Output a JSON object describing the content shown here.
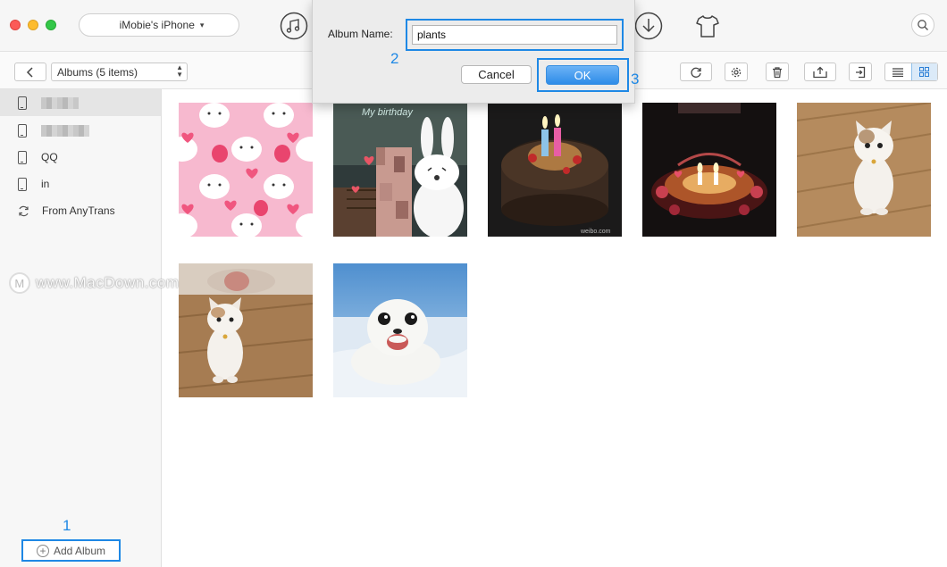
{
  "window": {
    "device_name": "iMobie's iPhone"
  },
  "header_icons": [
    "music-icon",
    "download-icon",
    "tshirt-icon",
    "search-icon"
  ],
  "toolbar": {
    "album_filter": "Albums (5 items)"
  },
  "sidebar": {
    "items": [
      {
        "label": "",
        "icon": "phone-icon",
        "selected": true
      },
      {
        "label": "",
        "icon": "phone-icon",
        "selected": false
      },
      {
        "label": "QQ",
        "icon": "phone-icon",
        "selected": false
      },
      {
        "label": "in",
        "icon": "phone-icon",
        "selected": false
      },
      {
        "label": "From AnyTrans",
        "icon": "sync-icon",
        "selected": false
      }
    ],
    "add_album_label": "Add Album"
  },
  "steps": {
    "one": "1",
    "two": "2",
    "three": "3"
  },
  "watermark": "www.MacDown.com",
  "photos": [
    {
      "name": "bunny-pattern"
    },
    {
      "name": "bunny-birthday",
      "caption": "My birthday"
    },
    {
      "name": "chocolate-cake",
      "caption": "weibo.com"
    },
    {
      "name": "candle-cake"
    },
    {
      "name": "cat-standing-1"
    },
    {
      "name": "cat-standing-2"
    },
    {
      "name": "baby-seal"
    }
  ],
  "dialog": {
    "label": "Album Name:",
    "input_value": "plants",
    "cancel_label": "Cancel",
    "ok_label": "OK"
  },
  "colors": {
    "accent": "#1e88e5",
    "ok_button": "#2e8ce8"
  }
}
